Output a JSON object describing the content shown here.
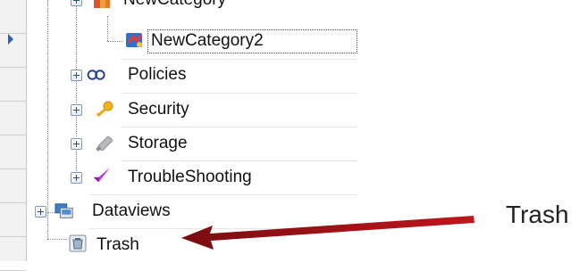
{
  "tree": {
    "items": [
      {
        "label": "NewCategory",
        "icon": "category-folder-icon"
      },
      {
        "label": "NewCategory2",
        "icon": "category-icon"
      },
      {
        "label": "Policies",
        "icon": "policies-icon"
      },
      {
        "label": "Security",
        "icon": "key-icon"
      },
      {
        "label": "Storage",
        "icon": "storage-icon"
      },
      {
        "label": "TroubleShooting",
        "icon": "troubleshooting-icon"
      },
      {
        "label": "Dataviews",
        "icon": "dataviews-icon"
      },
      {
        "label": "Trash",
        "icon": "trash-icon"
      }
    ]
  },
  "annotation": {
    "label": "Trash",
    "arrow_color": "#c0171c"
  }
}
